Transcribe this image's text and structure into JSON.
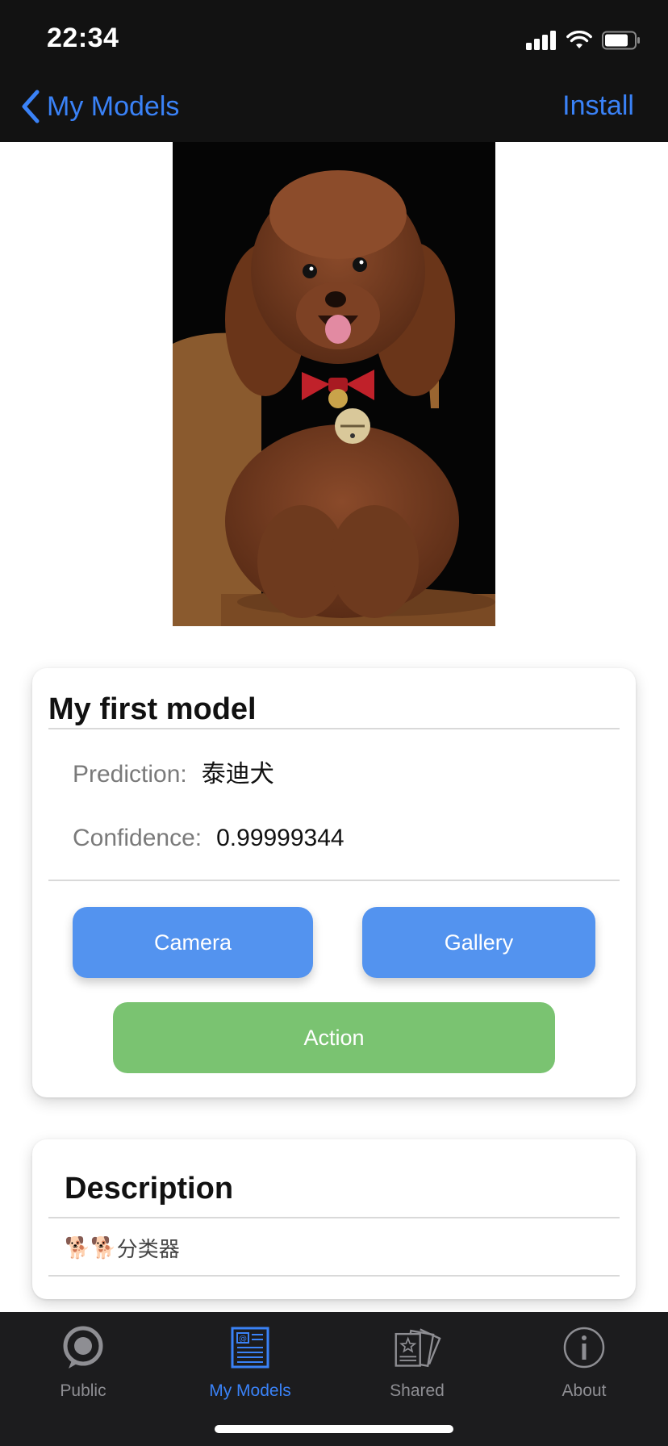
{
  "status_bar": {
    "time": "22:34"
  },
  "nav": {
    "back_label": "My Models",
    "action_label": "Install"
  },
  "model_card": {
    "title": "My first model",
    "prediction_label": "Prediction:",
    "prediction_value": "泰迪犬",
    "confidence_label": "Confidence:",
    "confidence_value": "0.99999344",
    "camera_label": "Camera",
    "gallery_label": "Gallery",
    "action_label": "Action"
  },
  "description": {
    "title": "Description",
    "text": "分类器",
    "emoji": "🐕🐕"
  },
  "tabs": [
    {
      "label": "Public",
      "icon": "public-icon",
      "active": false
    },
    {
      "label": "My Models",
      "icon": "my-models-icon",
      "active": true
    },
    {
      "label": "Shared",
      "icon": "shared-icon",
      "active": false
    },
    {
      "label": "About",
      "icon": "about-icon",
      "active": false
    }
  ],
  "colors": {
    "accent": "#3a82f7",
    "button_blue": "#5393ef",
    "button_green": "#7ac371",
    "bar_background": "#121212"
  }
}
